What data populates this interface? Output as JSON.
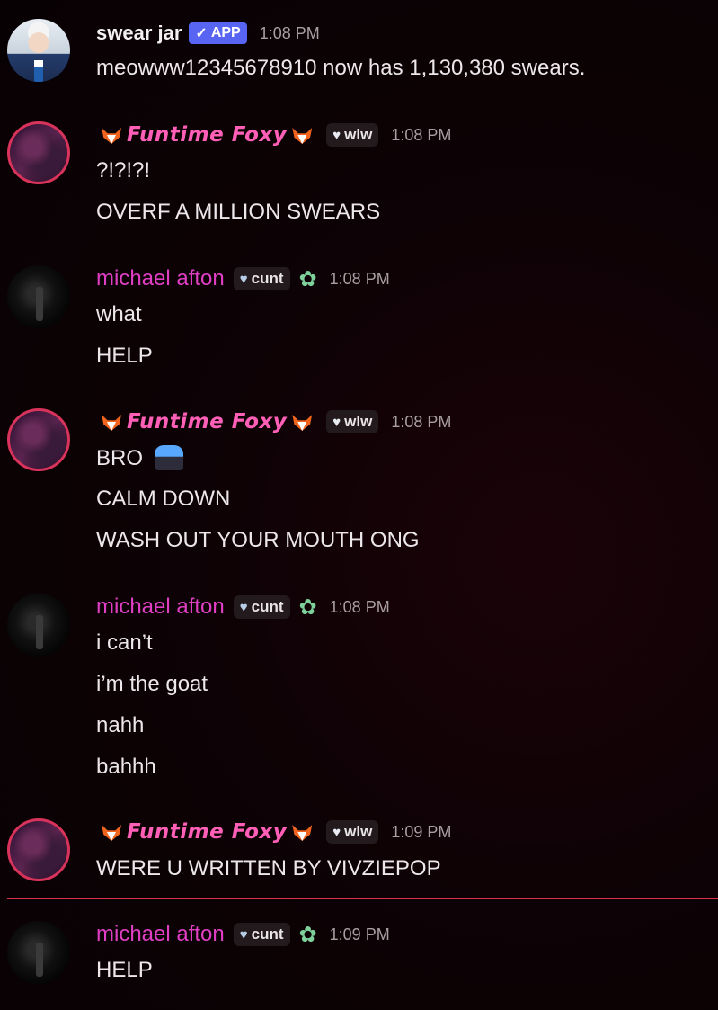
{
  "messages": [
    {
      "author": "swear jar",
      "badge": "APP",
      "badge_check": "✓",
      "time": "1:08 PM",
      "lines": [
        "meowww12345678910 now has 1,130,380 swears."
      ]
    },
    {
      "author": "Funtime Foxy",
      "tag": "wlw",
      "time": "1:08 PM",
      "lines": [
        "?!?!?!",
        "OVERF A MILLION SWEARS"
      ]
    },
    {
      "author": "michael afton",
      "tag": "cunt",
      "time": "1:08 PM",
      "lines": [
        "what",
        "HELP"
      ]
    },
    {
      "author": "Funtime Foxy",
      "tag": "wlw",
      "time": "1:08 PM",
      "lines": [
        "BRO",
        "CALM DOWN",
        "WASH OUT YOUR MOUTH ONG"
      ]
    },
    {
      "author": "michael afton",
      "tag": "cunt",
      "time": "1:08 PM",
      "lines": [
        "i can’t",
        "i’m the goat",
        "nahh",
        "bahhh"
      ]
    },
    {
      "author": "Funtime Foxy",
      "tag": "wlw",
      "time": "1:09 PM",
      "lines": [
        "WERE U WRITTEN BY VIVZIEPOP"
      ]
    },
    {
      "author": "michael afton",
      "tag": "cunt",
      "time": "1:09 PM",
      "lines": [
        "HELP"
      ]
    }
  ],
  "icons": {
    "fox": "fox-emoji",
    "heart": "white-heart-icon",
    "leaf": "green-heart-flower-icon",
    "bro": "screaming-face-emoji"
  },
  "colors": {
    "background": "#0d0205",
    "app_badge": "#5865f2",
    "foxy_name": "#ff5fb7",
    "michael_name": "#e03fc4",
    "new_divider": "#d8334a"
  }
}
